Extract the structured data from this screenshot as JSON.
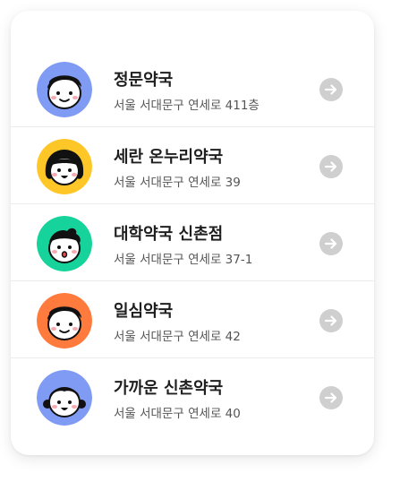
{
  "pharmacies": [
    {
      "name": "정문약국",
      "address": "서울 서대문구 연세로 411층",
      "avatar_color": "#7F9BF3",
      "hair_style": "short",
      "mouth": "smile"
    },
    {
      "name": "세란 온누리약국",
      "address": "서울 서대문구 연세로 39",
      "avatar_color": "#FFC627",
      "hair_style": "bob",
      "mouth": "open"
    },
    {
      "name": "대학약국 신촌점",
      "address": "서울 서대문구 연세로  37-1",
      "avatar_color": "#15D39A",
      "hair_style": "spiky",
      "mouth": "o"
    },
    {
      "name": "일심약국",
      "address": "서울 서대문구 연세로 42",
      "avatar_color": "#FF7A3D",
      "hair_style": "short",
      "mouth": "smile"
    },
    {
      "name": "가까운 신촌약국",
      "address": "서울 서대문구 연세로 40",
      "avatar_color": "#7F9BF3",
      "hair_style": "pigtails",
      "mouth": "open"
    }
  ],
  "colors": {
    "arrow_button": "#CFCFCF",
    "divider": "#ECECEC"
  },
  "icons": {
    "arrow": "arrow-right-icon"
  }
}
